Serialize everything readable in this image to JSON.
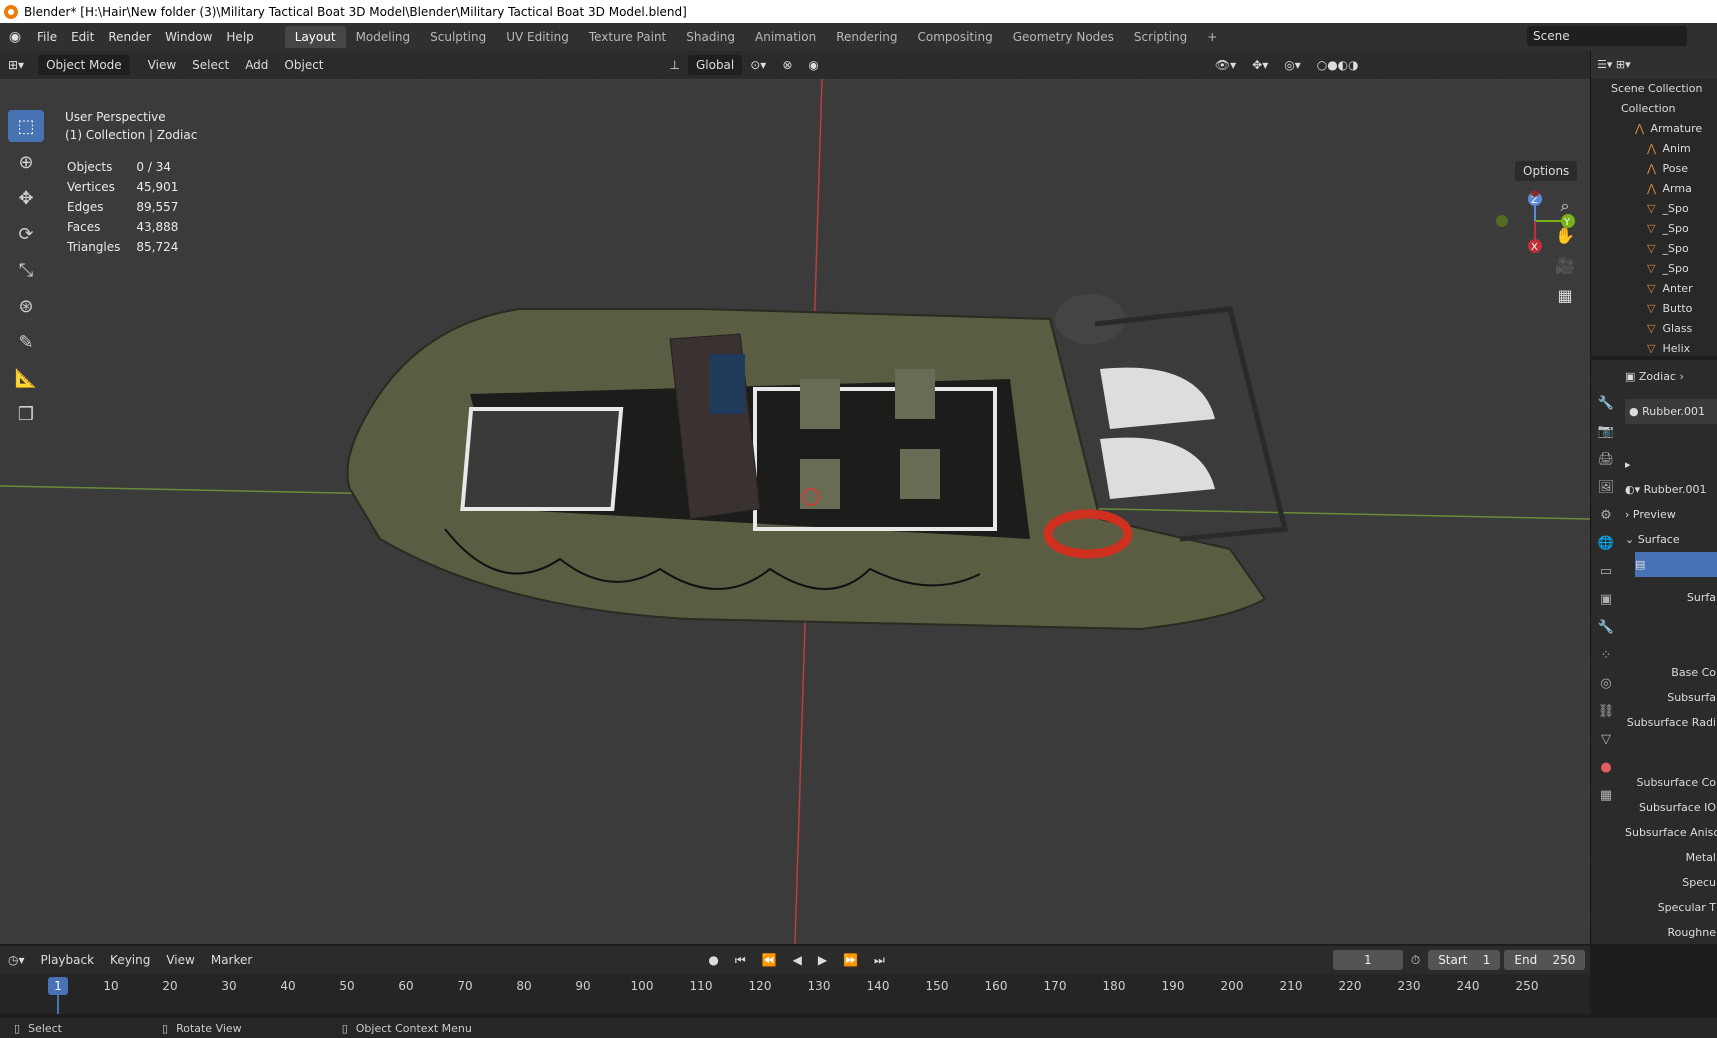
{
  "window_title": "Blender* [H:\\Hair\\New folder (3)\\Military Tactical Boat 3D Model\\Blender\\Military Tactical Boat 3D Model.blend]",
  "menu": [
    "File",
    "Edit",
    "Render",
    "Window",
    "Help"
  ],
  "workspaces": [
    "Layout",
    "Modeling",
    "Sculpting",
    "UV Editing",
    "Texture Paint",
    "Shading",
    "Animation",
    "Rendering",
    "Compositing",
    "Geometry Nodes",
    "Scripting"
  ],
  "active_workspace": "Layout",
  "scene": "Scene",
  "header": {
    "mode": "Object Mode",
    "view": "View",
    "select": "Select",
    "add": "Add",
    "object": "Object",
    "transform": "Global",
    "options": "Options"
  },
  "viewport": {
    "perspective": "User Perspective",
    "collection": "(1) Collection | Zodiac"
  },
  "stats": [
    {
      "label": "Objects",
      "value": "0 / 34"
    },
    {
      "label": "Vertices",
      "value": "45,901"
    },
    {
      "label": "Edges",
      "value": "89,557"
    },
    {
      "label": "Faces",
      "value": "43,888"
    },
    {
      "label": "Triangles",
      "value": "85,724"
    }
  ],
  "outliner": {
    "title": "Scene Collection",
    "collection": "Collection",
    "items": [
      "Armature",
      "Anim",
      "Pose",
      "Arma",
      "_Spo",
      "_Spo",
      "_Spo",
      "_Spo",
      "Anter",
      "Butto",
      "Glass",
      "Helix"
    ]
  },
  "properties": {
    "object": "Zodiac",
    "material_slot": "Rubber.001",
    "material": "Rubber.001",
    "preview": "Preview",
    "surface": "Surface",
    "surface_field": "Surfa",
    "rows": [
      "Base Co",
      "Subsurfa",
      "Subsurface Radi",
      "Subsurface Co",
      "Subsurface IO",
      "Subsurface Aniso",
      "Metal",
      "Specu",
      "Specular T",
      "Roughne"
    ]
  },
  "timeline": {
    "playback": "Playback",
    "keying": "Keying",
    "view": "View",
    "marker": "Marker",
    "current_frame": "1",
    "start_label": "Start",
    "start": "1",
    "end_label": "End",
    "end": "250",
    "ticks": [
      "10",
      "20",
      "30",
      "40",
      "50",
      "60",
      "70",
      "80",
      "90",
      "100",
      "110",
      "120",
      "130",
      "140",
      "150",
      "160",
      "170",
      "180",
      "190",
      "200",
      "210",
      "220",
      "230",
      "240",
      "250"
    ]
  },
  "status": {
    "select": "Select",
    "rotate": "Rotate View",
    "context": "Object Context Menu"
  }
}
